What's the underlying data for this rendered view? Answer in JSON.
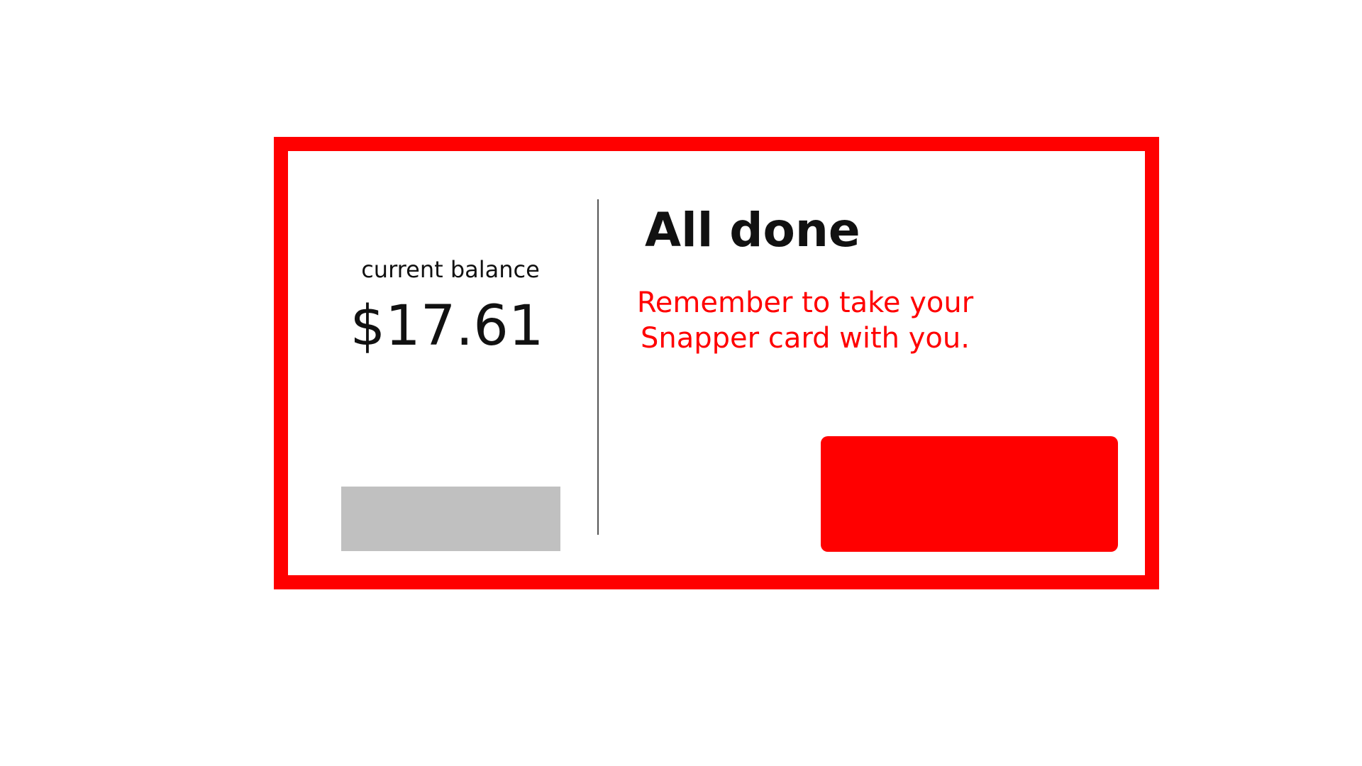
{
  "balance": {
    "label": "current balance",
    "amount": "$17.61"
  },
  "status": {
    "title": "All done",
    "reminder_line1": "Remember to take your",
    "reminder_line2": "Snapper card with you."
  },
  "colors": {
    "accent": "#ff0000",
    "secondary_button": "#c0c0c0",
    "text": "#111111"
  }
}
